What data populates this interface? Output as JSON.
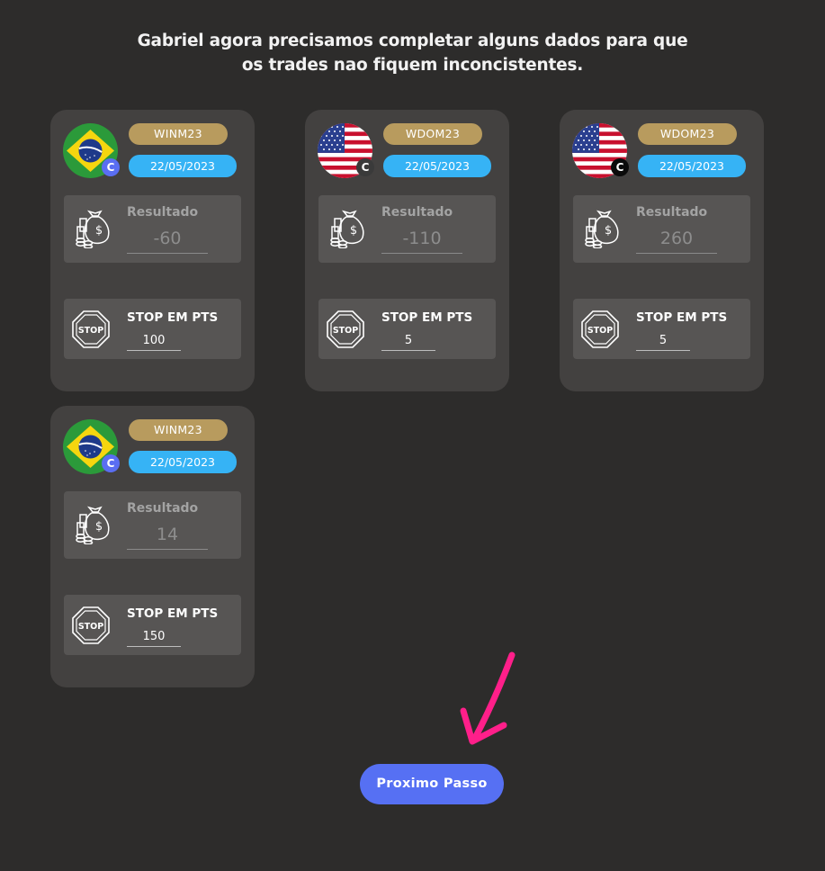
{
  "heading": {
    "line1": "Gabriel agora precisamos completar alguns dados para que",
    "line2": "os trades nao fiquem inconcistentes."
  },
  "cards": [
    {
      "flag": "brazil-flag-icon",
      "badge": "C",
      "badge_color": "#5a6ef2",
      "ticker": "WINM23",
      "date": "22/05/2023",
      "result_label": "Resultado",
      "result": "-60",
      "stop_label": "STOP EM PTS",
      "stop_value": "100"
    },
    {
      "flag": "usa-flag-icon",
      "badge": "C",
      "badge_color": "#3a3a3a",
      "ticker": "WDOM23",
      "date": "22/05/2023",
      "result_label": "Resultado",
      "result": "-110",
      "stop_label": "STOP EM PTS",
      "stop_value": "5"
    },
    {
      "flag": "usa-flag-icon",
      "badge": "C",
      "badge_color": "#0b0b0b",
      "ticker": "WDOM23",
      "date": "22/05/2023",
      "result_label": "Resultado",
      "result": "260",
      "stop_label": "STOP EM PTS",
      "stop_value": "5"
    },
    {
      "flag": "brazil-flag-icon",
      "badge": "C",
      "badge_color": "#5a6ef2",
      "ticker": "WINM23",
      "date": "22/05/2023",
      "result_label": "Resultado",
      "result": "14",
      "stop_label": "STOP EM PTS",
      "stop_value": "150"
    }
  ],
  "icons": {
    "result": "money-bag-coins-icon",
    "stop": "stop-sign-icon",
    "arrow": "pink-arrow-down-icon"
  },
  "next_button": {
    "label": "Proximo Passo"
  },
  "colors": {
    "background": "#2d2c2b",
    "card": "#434140",
    "ticker": "#b89b5e",
    "date": "#36b3f5",
    "button": "#5670f3",
    "arrow": "#ff1f8a"
  }
}
